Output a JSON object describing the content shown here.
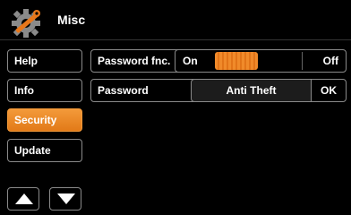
{
  "header": {
    "title": "Misc",
    "icon": "settings-wrench-icon"
  },
  "sidebar": {
    "items": [
      {
        "label": "Help",
        "active": false
      },
      {
        "label": "Info",
        "active": false
      },
      {
        "label": "Security",
        "active": true
      },
      {
        "label": "Update",
        "active": false
      }
    ],
    "up_icon": "arrow-up-icon",
    "down_icon": "arrow-down-icon"
  },
  "settings": {
    "password_fnc": {
      "label": "Password fnc.",
      "on_label": "On",
      "off_label": "Off"
    },
    "password": {
      "label": "Password",
      "value": "Anti Theft",
      "ok_label": "OK"
    }
  },
  "colors": {
    "accent": "#f08a2a",
    "background": "#000000",
    "border": "#8a8a8a"
  }
}
